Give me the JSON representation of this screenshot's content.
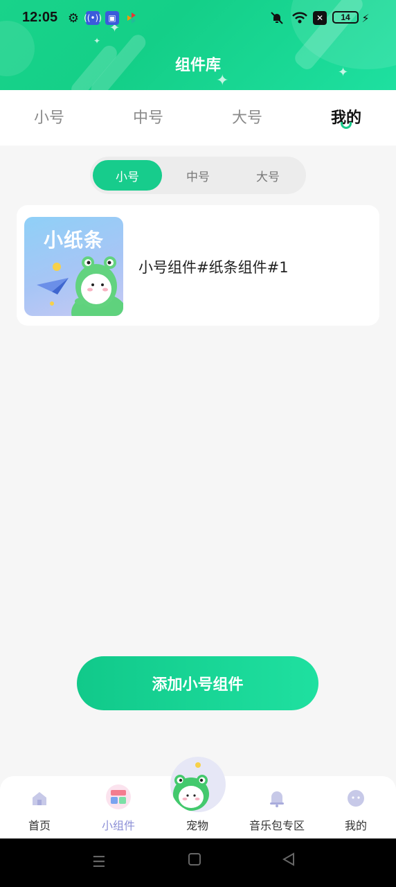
{
  "status_bar": {
    "time": "12:05",
    "battery": "14"
  },
  "header": {
    "title": "组件库"
  },
  "top_tabs": [
    {
      "label": "小号"
    },
    {
      "label": "中号"
    },
    {
      "label": "大号"
    },
    {
      "label": "我的"
    }
  ],
  "segment_tabs": [
    {
      "label": "小号"
    },
    {
      "label": "中号"
    },
    {
      "label": "大号"
    }
  ],
  "widget_card": {
    "thumbnail_title": "小纸条",
    "label": "小号组件#纸条组件#1"
  },
  "add_button": {
    "label": "添加小号组件"
  },
  "bottom_nav": [
    {
      "label": "首页",
      "icon": "home-icon"
    },
    {
      "label": "小组件",
      "icon": "widgets-icon"
    },
    {
      "label": "宠物",
      "icon": "pet-frog-icon"
    },
    {
      "label": "音乐包专区",
      "icon": "bell-icon"
    },
    {
      "label": "我的",
      "icon": "profile-icon"
    }
  ],
  "colors": {
    "accent": "#17cc8c",
    "nav_active": "#8c8fd6"
  }
}
